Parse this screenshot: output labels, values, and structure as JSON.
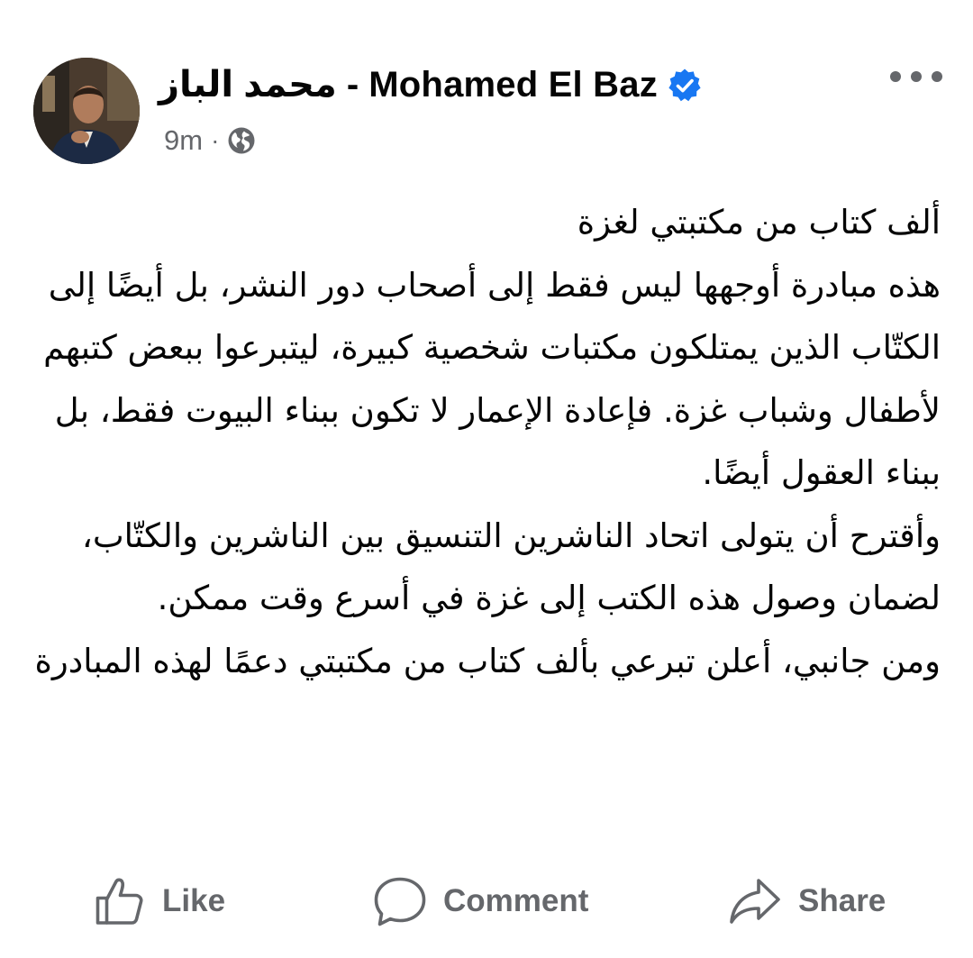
{
  "post": {
    "author_name": "محمد الباز - Mohamed El Baz",
    "verified": true,
    "time": "9m",
    "separator": "·",
    "audience_icon": "globe-icon",
    "more_icon": "more-horizontal-icon",
    "text_lines": [
      "ألف كتاب من مكتبتي لغزة",
      "هذه مبادرة أوجهها ليس فقط إلى أصحاب دور النشر، بل أيضًا إلى الكتّاب الذين يمتلكون مكتبات شخصية كبيرة، ليتبرعوا ببعض كتبهم لأطفال وشباب غزة. فإعادة الإعمار لا تكون ببناء البيوت فقط، بل ببناء العقول أيضًا.",
      "وأقترح أن يتولى اتحاد الناشرين التنسيق بين الناشرين والكتّاب، لضمان وصول هذه الكتب إلى غزة في أسرع وقت ممكن.",
      "ومن جانبي، أعلن تبرعي بألف كتاب من مكتبتي دعمًا لهذه المبادرة"
    ]
  },
  "actions": {
    "like_label": "Like",
    "comment_label": "Comment",
    "share_label": "Share"
  },
  "colors": {
    "text_primary": "#050505",
    "text_secondary": "#65676b",
    "verified_blue": "#1877f2",
    "background": "#ffffff"
  }
}
